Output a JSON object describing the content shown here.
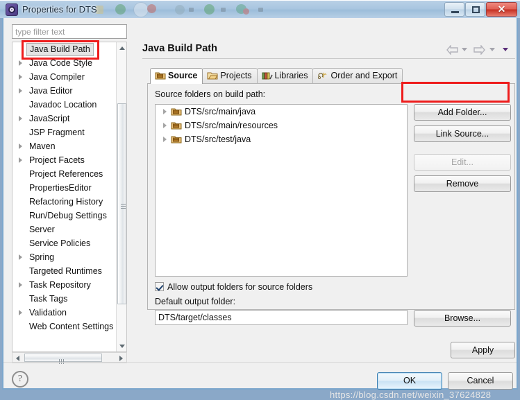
{
  "window": {
    "title": "Properties for DTS",
    "app_icon": "eclipse-properties-icon",
    "minimize_label": "Minimize",
    "maximize_label": "Maximize",
    "close_label": "Close",
    "close_glyph": "✕"
  },
  "sidebar": {
    "filter": {
      "value": "",
      "placeholder": "type filter text"
    },
    "items": [
      {
        "label": "Java Build Path",
        "expandable": false,
        "selected": true
      },
      {
        "label": "Java Code Style",
        "expandable": true,
        "selected": false
      },
      {
        "label": "Java Compiler",
        "expandable": true,
        "selected": false
      },
      {
        "label": "Java Editor",
        "expandable": true,
        "selected": false
      },
      {
        "label": "Javadoc Location",
        "expandable": false,
        "selected": false
      },
      {
        "label": "JavaScript",
        "expandable": true,
        "selected": false
      },
      {
        "label": "JSP Fragment",
        "expandable": false,
        "selected": false
      },
      {
        "label": "Maven",
        "expandable": true,
        "selected": false
      },
      {
        "label": "Project Facets",
        "expandable": true,
        "selected": false
      },
      {
        "label": "Project References",
        "expandable": false,
        "selected": false
      },
      {
        "label": "PropertiesEditor",
        "expandable": false,
        "selected": false
      },
      {
        "label": "Refactoring History",
        "expandable": false,
        "selected": false
      },
      {
        "label": "Run/Debug Settings",
        "expandable": false,
        "selected": false
      },
      {
        "label": "Server",
        "expandable": false,
        "selected": false
      },
      {
        "label": "Service Policies",
        "expandable": false,
        "selected": false
      },
      {
        "label": "Spring",
        "expandable": true,
        "selected": false
      },
      {
        "label": "Targeted Runtimes",
        "expandable": false,
        "selected": false
      },
      {
        "label": "Task Repository",
        "expandable": true,
        "selected": false
      },
      {
        "label": "Task Tags",
        "expandable": false,
        "selected": false
      },
      {
        "label": "Validation",
        "expandable": true,
        "selected": false
      },
      {
        "label": "Web Content Settings",
        "expandable": false,
        "selected": false
      }
    ]
  },
  "page": {
    "title": "Java Build Path",
    "nav": {
      "back": "back-arrow",
      "back_menu": "back-dropdown",
      "forward": "forward-arrow",
      "forward_menu": "forward-dropdown",
      "view_menu": "view-menu"
    },
    "tabs": [
      {
        "label": "Source",
        "icon": "source-folder-icon",
        "active": true
      },
      {
        "label": "Projects",
        "icon": "projects-icon",
        "active": false
      },
      {
        "label": "Libraries",
        "icon": "libraries-icon",
        "active": false
      },
      {
        "label": "Order and Export",
        "icon": "order-export-icon",
        "active": false
      }
    ],
    "source_label": "Source folders on build path:",
    "source_folders": [
      {
        "label": "DTS/src/main/java"
      },
      {
        "label": "DTS/src/main/resources"
      },
      {
        "label": "DTS/src/test/java"
      }
    ],
    "side_buttons": [
      {
        "label": "Add Folder...",
        "enabled": true,
        "highlighted": true
      },
      {
        "label": "Link Source...",
        "enabled": true,
        "highlighted": false
      },
      {
        "label": "Edit...",
        "enabled": false,
        "highlighted": false
      },
      {
        "label": "Remove",
        "enabled": true,
        "highlighted": false
      }
    ],
    "allow_output_checkbox": {
      "label": "Allow output folders for source folders",
      "checked": true
    },
    "default_output_label": "Default output folder:",
    "default_output_value": "DTS/target/classes",
    "browse_label": "Browse...",
    "apply_label": "Apply"
  },
  "footer": {
    "help": "?",
    "ok": "OK",
    "cancel": "Cancel"
  },
  "watermark": "https://blog.csdn.net/weixin_37624828",
  "colors": {
    "accent": "#3c7fb1",
    "highlight": "#ee1c1c",
    "titlebar": "#a9c6e0",
    "dialog_bg": "#f0f0f0"
  }
}
